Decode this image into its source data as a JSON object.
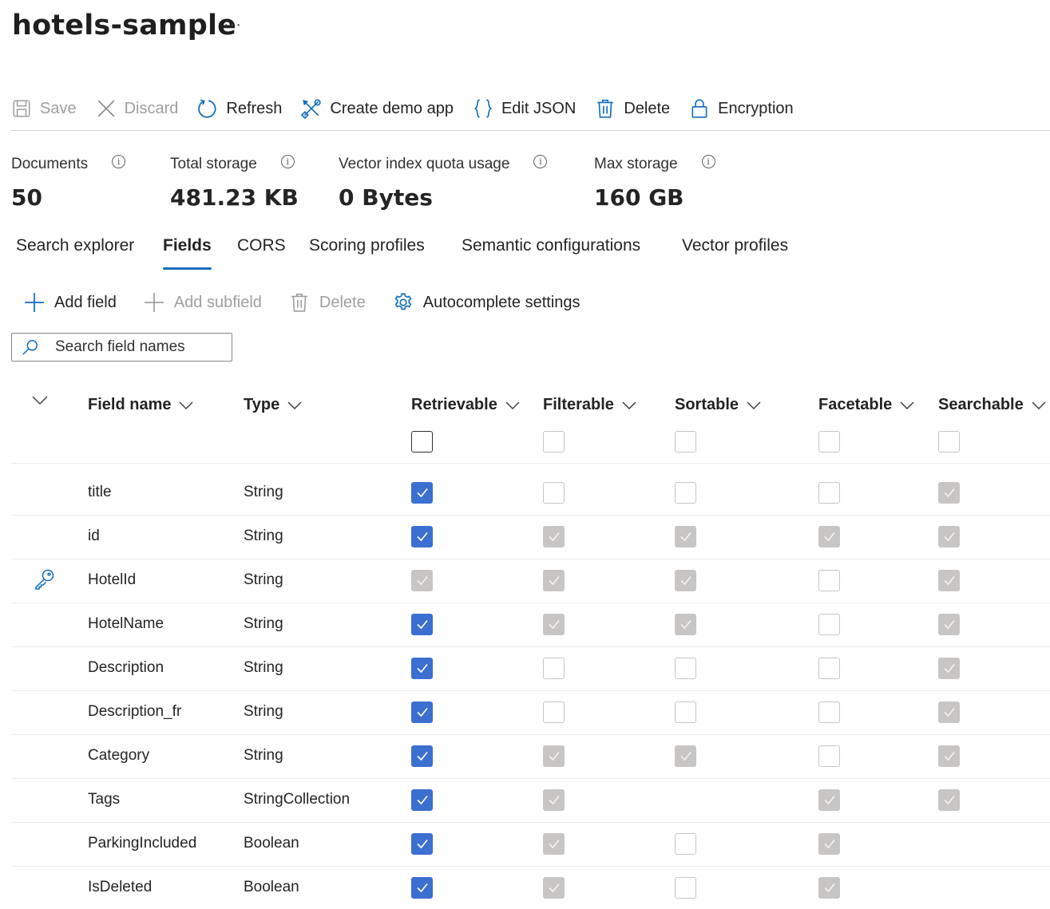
{
  "page": {
    "title": "hotels-sample",
    "more": "···"
  },
  "toolbar": {
    "save": "Save",
    "discard": "Discard",
    "refresh": "Refresh",
    "create_demo_app": "Create demo app",
    "edit_json": "Edit JSON",
    "delete": "Delete",
    "encryption": "Encryption"
  },
  "stats": {
    "documents": {
      "label": "Documents",
      "value": "50"
    },
    "total_storage": {
      "label": "Total storage",
      "value": "481.23 KB"
    },
    "vector_quota": {
      "label": "Vector index quota usage",
      "value": "0 Bytes"
    },
    "max_storage": {
      "label": "Max storage",
      "value": "160 GB"
    },
    "info_glyph": "i"
  },
  "tabs": [
    "Search explorer",
    "Fields",
    "CORS",
    "Scoring profiles",
    "Semantic configurations",
    "Vector profiles"
  ],
  "active_tab": "Fields",
  "fields_toolbar": {
    "add_field": "Add field",
    "add_subfield": "Add subfield",
    "delete": "Delete",
    "autocomplete": "Autocomplete settings"
  },
  "search": {
    "placeholder": "Search field names",
    "value": ""
  },
  "columns": [
    "Field name",
    "Type",
    "Retrievable",
    "Filterable",
    "Sortable",
    "Facetable",
    "Searchable"
  ],
  "accent_color": "#3b6fd0",
  "rows": [
    {
      "name": "title",
      "type": "String",
      "key": false,
      "retrievable": "on",
      "filterable": "off",
      "sortable": "off",
      "facetable": "off",
      "searchable": "dis-on"
    },
    {
      "name": "id",
      "type": "String",
      "key": false,
      "retrievable": "on",
      "filterable": "dis-on",
      "sortable": "dis-on",
      "facetable": "dis-on",
      "searchable": "dis-on"
    },
    {
      "name": "HotelId",
      "type": "String",
      "key": true,
      "retrievable": "dis-on",
      "filterable": "dis-on",
      "sortable": "dis-on",
      "facetable": "off",
      "searchable": "dis-on"
    },
    {
      "name": "HotelName",
      "type": "String",
      "key": false,
      "retrievable": "on",
      "filterable": "dis-on",
      "sortable": "dis-on",
      "facetable": "off",
      "searchable": "dis-on"
    },
    {
      "name": "Description",
      "type": "String",
      "key": false,
      "retrievable": "on",
      "filterable": "off",
      "sortable": "off",
      "facetable": "off",
      "searchable": "dis-on"
    },
    {
      "name": "Description_fr",
      "type": "String",
      "key": false,
      "retrievable": "on",
      "filterable": "off",
      "sortable": "off",
      "facetable": "off",
      "searchable": "dis-on"
    },
    {
      "name": "Category",
      "type": "String",
      "key": false,
      "retrievable": "on",
      "filterable": "dis-on",
      "sortable": "dis-on",
      "facetable": "off",
      "searchable": "dis-on"
    },
    {
      "name": "Tags",
      "type": "StringCollection",
      "key": false,
      "retrievable": "on",
      "filterable": "dis-on",
      "sortable": "none",
      "facetable": "dis-on",
      "searchable": "dis-on"
    },
    {
      "name": "ParkingIncluded",
      "type": "Boolean",
      "key": false,
      "retrievable": "on",
      "filterable": "dis-on",
      "sortable": "off",
      "facetable": "dis-on",
      "searchable": "none"
    },
    {
      "name": "IsDeleted",
      "type": "Boolean",
      "key": false,
      "retrievable": "on",
      "filterable": "dis-on",
      "sortable": "off",
      "facetable": "dis-on",
      "searchable": "none"
    }
  ]
}
